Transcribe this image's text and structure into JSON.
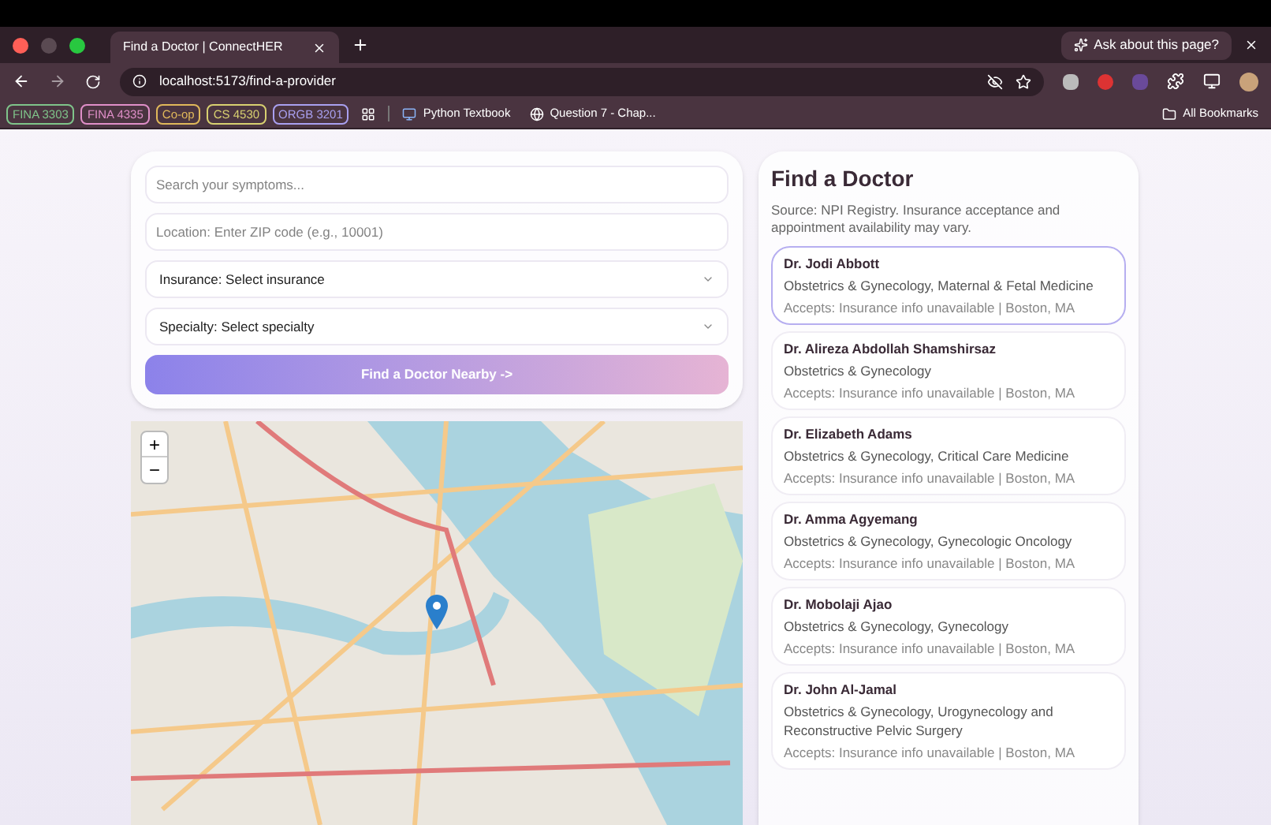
{
  "browser": {
    "tab_title": "Find a Doctor | ConnectHER",
    "ask_button": "Ask about this page?",
    "url": "localhost:5173/find-a-provider",
    "bookmarks": [
      {
        "label": "FINA 3303",
        "color": "#7fc48a"
      },
      {
        "label": "FINA 4335",
        "color": "#e08fc8"
      },
      {
        "label": "Co-op",
        "color": "#e0b85a"
      },
      {
        "label": "CS 4530",
        "color": "#d8d070"
      },
      {
        "label": "ORGB 3201",
        "color": "#a9a0f0"
      }
    ],
    "bookmark_links": [
      "Python Textbook",
      "Question 7 - Chap..."
    ],
    "all_bookmarks": "All Bookmarks"
  },
  "search": {
    "symptoms_placeholder": "Search your symptoms...",
    "location_placeholder": "Location: Enter ZIP code (e.g., 10001)",
    "insurance": "Insurance: Select insurance",
    "specialty": "Specialty: Select specialty",
    "button": "Find a Doctor Nearby ->"
  },
  "map": {
    "zoom_in": "+",
    "zoom_out": "−"
  },
  "results": {
    "title": "Find a Doctor",
    "source": "Source: NPI Registry. Insurance acceptance and appointment availability may vary.",
    "doctors": [
      {
        "name": "Dr. Jodi Abbott",
        "specialty": "Obstetrics & Gynecology, Maternal & Fetal Medicine",
        "accepts": "Accepts: Insurance info unavailable | Boston, MA",
        "selected": true
      },
      {
        "name": "Dr. Alireza Abdollah Shamshirsaz",
        "specialty": "Obstetrics & Gynecology",
        "accepts": "Accepts: Insurance info unavailable | Boston, MA",
        "selected": false
      },
      {
        "name": "Dr. Elizabeth Adams",
        "specialty": "Obstetrics & Gynecology, Critical Care Medicine",
        "accepts": "Accepts: Insurance info unavailable | Boston, MA",
        "selected": false
      },
      {
        "name": "Dr. Amma Agyemang",
        "specialty": "Obstetrics & Gynecology, Gynecologic Oncology",
        "accepts": "Accepts: Insurance info unavailable | Boston, MA",
        "selected": false
      },
      {
        "name": "Dr. Mobolaji Ajao",
        "specialty": "Obstetrics & Gynecology, Gynecology",
        "accepts": "Accepts: Insurance info unavailable | Boston, MA",
        "selected": false
      },
      {
        "name": "Dr. John Al-Jamal",
        "specialty": "Obstetrics & Gynecology, Urogynecology and Reconstructive Pelvic Surgery",
        "accepts": "Accepts: Insurance info unavailable | Boston, MA",
        "selected": false
      }
    ]
  }
}
